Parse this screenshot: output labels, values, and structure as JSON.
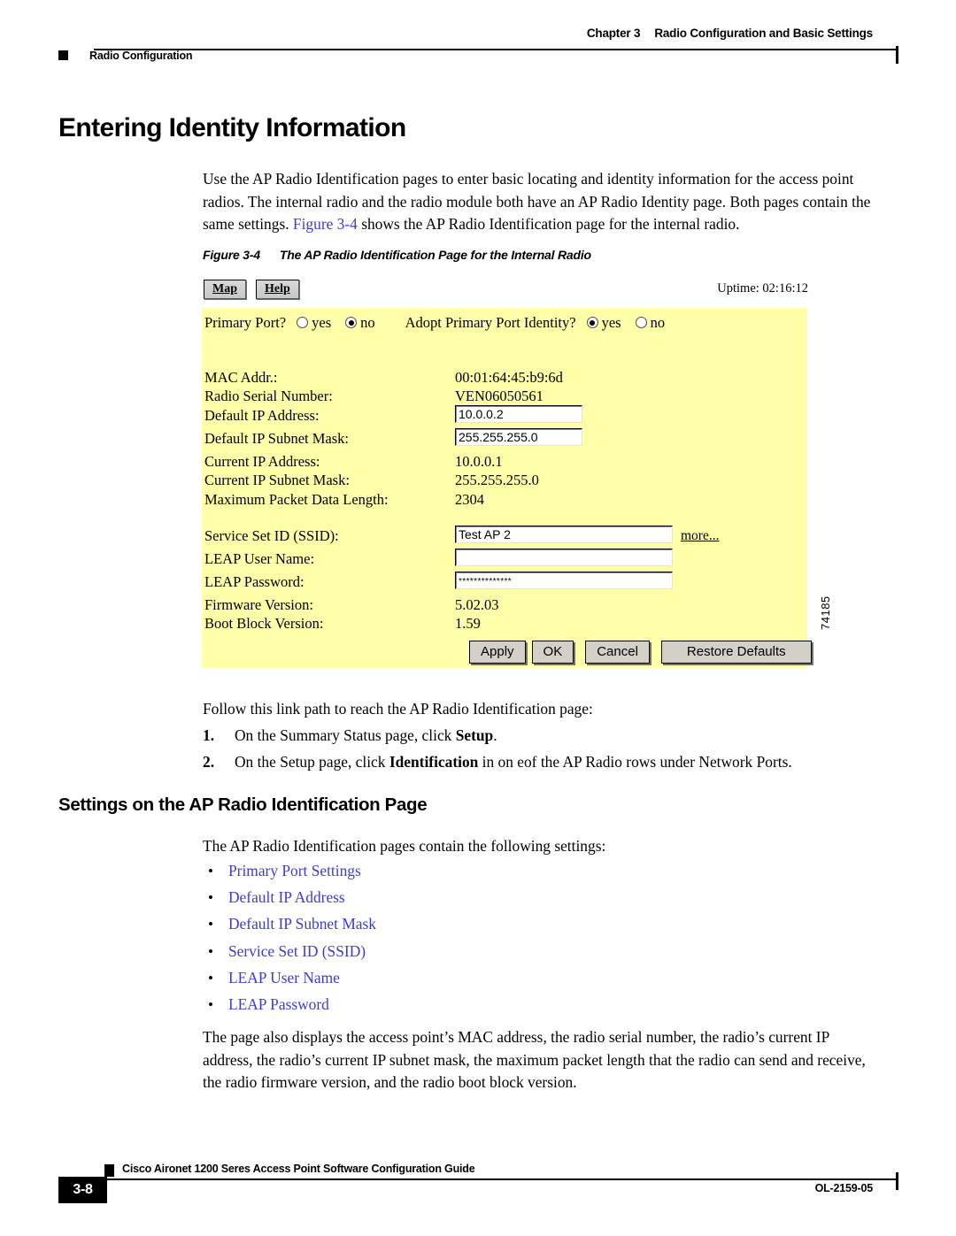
{
  "header": {
    "chapter_number": "Chapter 3",
    "chapter_title": "Radio Configuration and Basic Settings",
    "topic": "Radio Configuration"
  },
  "h1": "Entering Identity Information",
  "intro_paragraph": {
    "part1": "Use the AP Radio Identification pages to enter basic locating and identity information for the access point radios. The internal radio and the radio module both have an AP Radio Identity page. Both pages contain the same settings. ",
    "link": "Figure 3-4",
    "part2": " shows the AP Radio Identification page for the internal radio."
  },
  "figure": {
    "caption_number": "Figure 3-4",
    "caption_text": "The AP Radio Identification Page for the Internal Radio",
    "figure_id": "74185",
    "toolbar": {
      "map_label": "Map",
      "help_label": "Help",
      "uptime": "Uptime: 02:16:12"
    },
    "primary_port": {
      "label": "Primary Port?",
      "yes_label": "yes",
      "no_label": "no",
      "selected": "no"
    },
    "adopt_identity": {
      "label": "Adopt Primary Port Identity?",
      "yes_label": "yes",
      "no_label": "no",
      "selected": "yes"
    },
    "fields": {
      "mac_addr_label": "MAC Addr.:",
      "mac_addr_value": "00:01:64:45:b9:6d",
      "radio_serial_label": "Radio Serial Number:",
      "radio_serial_value": "VEN06050561",
      "default_ip_label": "Default IP Address:",
      "default_ip_value": "10.0.0.2",
      "default_mask_label": "Default IP Subnet Mask:",
      "default_mask_value": "255.255.255.0",
      "current_ip_label": "Current IP Address:",
      "current_ip_value": "10.0.0.1",
      "current_mask_label": "Current IP Subnet Mask:",
      "current_mask_value": "255.255.255.0",
      "max_packet_label": "Maximum Packet Data Length:",
      "max_packet_value": "2304",
      "ssid_label": "Service Set ID (SSID):",
      "ssid_value": "Test AP 2",
      "ssid_more_link": "more...",
      "leap_user_label": "LEAP User Name:",
      "leap_user_value": "",
      "leap_pass_label": "LEAP Password:",
      "leap_pass_value": "**************",
      "firmware_label": "Firmware Version:",
      "firmware_value": "5.02.03",
      "bootblock_label": "Boot Block Version:",
      "bootblock_value": "1.59"
    },
    "buttons": {
      "apply": "Apply",
      "ok": "OK",
      "cancel": "Cancel",
      "restore_defaults": "Restore Defaults"
    }
  },
  "link_path_intro": "Follow this link path to reach the AP Radio Identification page:",
  "steps": [
    {
      "num": "1.",
      "pre": "On the Summary Status page, click ",
      "bold": "Setup",
      "post": "."
    },
    {
      "num": "2.",
      "pre": "On the Setup page, click ",
      "bold": "Identification",
      "post": " in on eof the AP Radio rows under Network Ports."
    }
  ],
  "h2": "Settings on the AP Radio Identification Page",
  "settings_intro": "The AP Radio Identification pages contain the following settings:",
  "settings_bullets": [
    "Primary Port Settings",
    "Default IP Address",
    "Default IP Subnet Mask",
    "Service Set ID (SSID)",
    "LEAP User Name",
    "LEAP Password"
  ],
  "closing_paragraph": "The page also displays the access point’s MAC address, the radio serial number, the radio’s current IP address, the radio’s current IP subnet mask, the maximum packet length that the radio can send and receive, the radio firmware version, and the radio boot block version.",
  "footer": {
    "page_number": "3-8",
    "guide_title": "Cisco Aironet 1200 Seres Access Point Software Configuration Guide",
    "doc_number": "OL-2159-05"
  },
  "colors": {
    "panel_yellow": "#ffffaa",
    "link_blue": "#3b3bd6",
    "button_face": "#d4d0c8"
  }
}
